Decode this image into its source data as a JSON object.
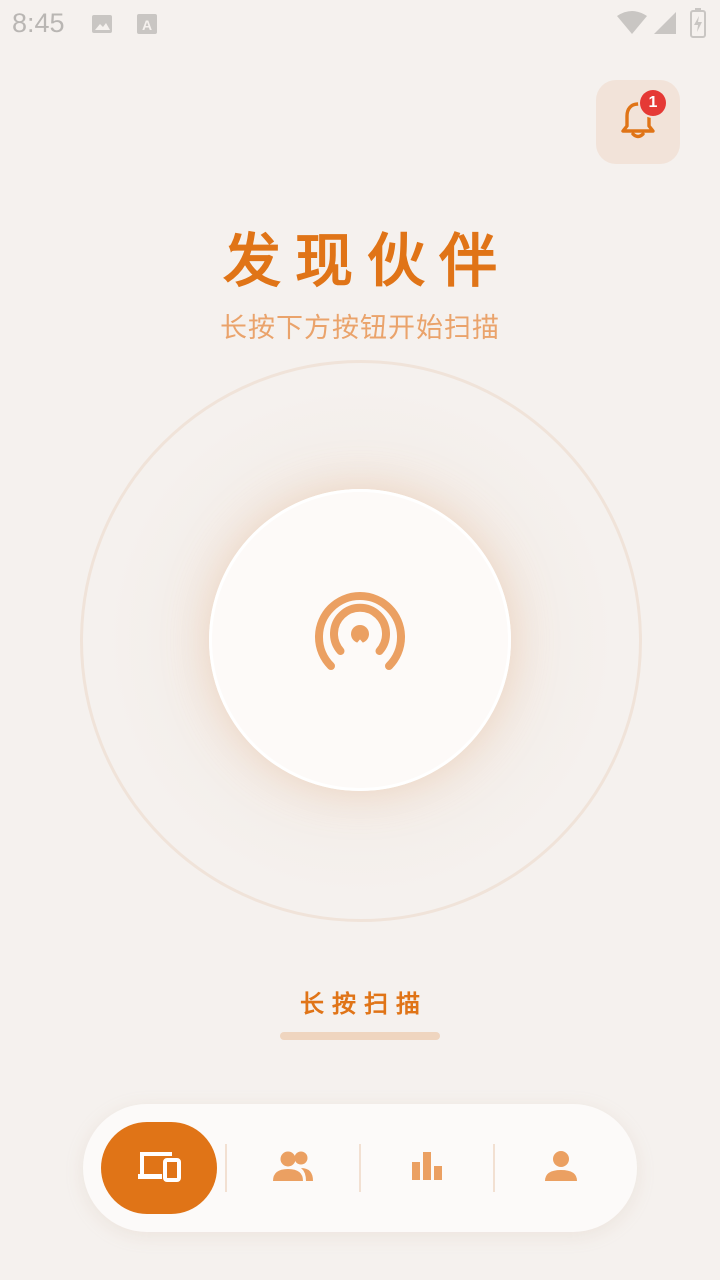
{
  "status_bar": {
    "time": "8:45",
    "icons": [
      "image-icon",
      "font-icon",
      "wifi-icon",
      "signal-icon",
      "battery-icon"
    ]
  },
  "notifications": {
    "icon": "bell-icon",
    "badge_count": "1"
  },
  "header": {
    "title": "发现伙伴",
    "subtitle": "长按下方按钮开始扫描"
  },
  "scan": {
    "icon": "broadcast-icon",
    "label": "长按扫描"
  },
  "bottom_nav": {
    "items": [
      {
        "name": "devices",
        "icon": "devices-icon",
        "active": true
      },
      {
        "name": "partners",
        "icon": "people-icon",
        "active": false
      },
      {
        "name": "stats",
        "icon": "bar-chart-icon",
        "active": false
      },
      {
        "name": "profile",
        "icon": "person-icon",
        "active": false
      }
    ]
  },
  "colors": {
    "accent": "#E07417",
    "accent_light": "#EAA36B",
    "background": "#F5F1EE",
    "badge": "#E53935"
  }
}
